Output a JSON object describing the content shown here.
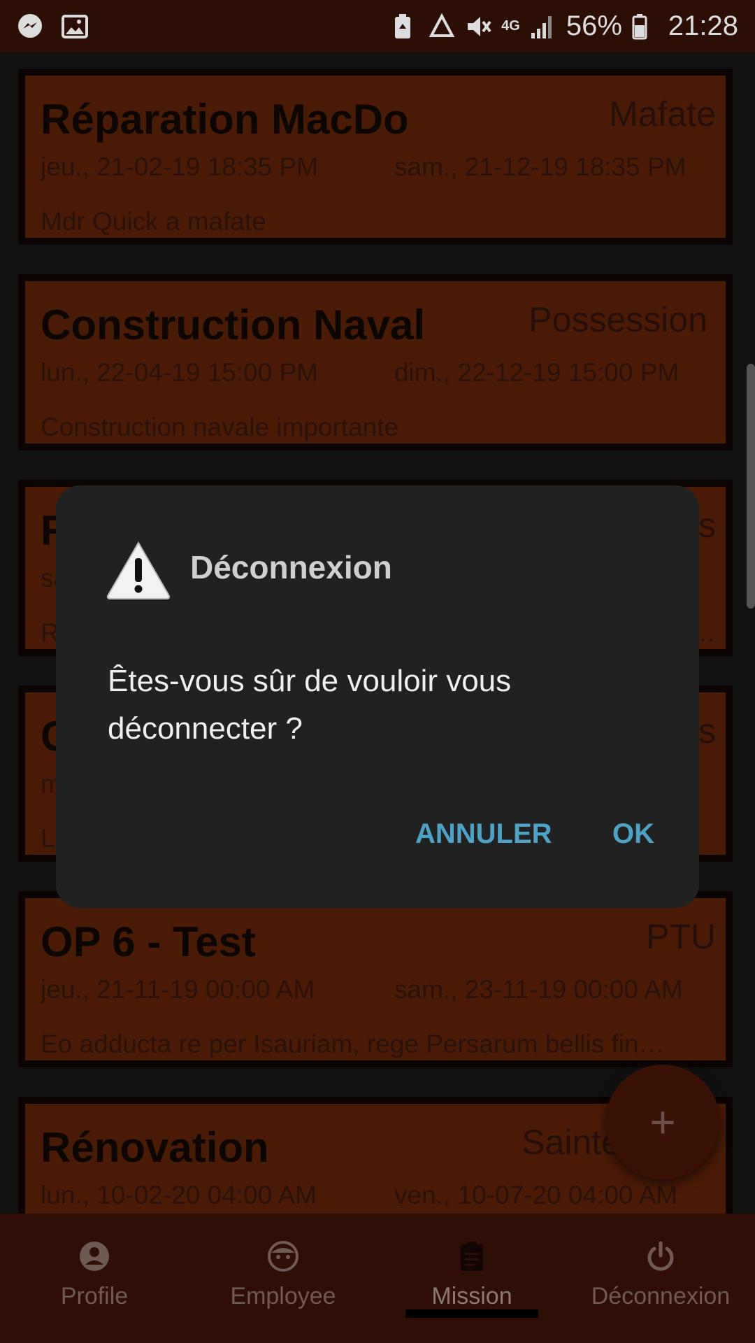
{
  "status_bar": {
    "left_icons": [
      "messenger-icon",
      "gallery-icon"
    ],
    "right_icons": [
      "battery-saver-icon",
      "recycle-icon",
      "mute-icon",
      "4g-icon",
      "signal-icon",
      "battery-icon"
    ],
    "network_label": "4G",
    "battery": "56%",
    "time": "21:28"
  },
  "missions": [
    {
      "title": "Réparation MacDo",
      "location": "Mafate",
      "start": "jeu., 21-02-19  18:35 PM",
      "end": "sam., 21-12-19  18:35 PM",
      "description": "Mdr Quick a mafate"
    },
    {
      "title": "Construction Naval",
      "location": "Possession",
      "start": "lun., 22-04-19  15:00 PM",
      "end": "dim., 22-12-19  15:00 PM",
      "description": "Construction navale importante"
    },
    {
      "title": "R",
      "location": "is",
      "start": "sa",
      "end": "",
      "description": "Ro"
    },
    {
      "title": "C",
      "location": "is",
      "start": "m",
      "end": "",
      "description": "Lo"
    },
    {
      "title": "OP 6 - Test",
      "location": "PTU",
      "start": "jeu., 21-11-19  00:00 AM",
      "end": "sam., 23-11-19  00:00 AM",
      "description": "Eo adducta re per Isauriam, rege Persarum bellis fin…"
    },
    {
      "title": "Rénovation",
      "location": "Sainte",
      "start": "lun., 10-02-20  04:00 AM",
      "end": "ven., 10-07-20  04:00 AM",
      "description": ""
    }
  ],
  "partial_ellipsis": "…",
  "fab": {
    "label": "+"
  },
  "bottom_nav": {
    "items": [
      {
        "label": "Profile",
        "icon": "profile-icon"
      },
      {
        "label": "Employee",
        "icon": "face-icon"
      },
      {
        "label": "Mission",
        "icon": "clipboard-icon"
      },
      {
        "label": "Déconnexion",
        "icon": "power-icon"
      }
    ],
    "active_index": 2
  },
  "dialog": {
    "title": "Déconnexion",
    "message": "Êtes-vous sûr de vouloir vous déconnecter ?",
    "cancel_label": "ANNULER",
    "ok_label": "OK",
    "icon": "warning-icon"
  },
  "colors": {
    "card_bg": "#4a1c06",
    "dialog_bg": "#212121",
    "accent_button": "#4da3c7",
    "nav_bg": "#2f0e05"
  }
}
